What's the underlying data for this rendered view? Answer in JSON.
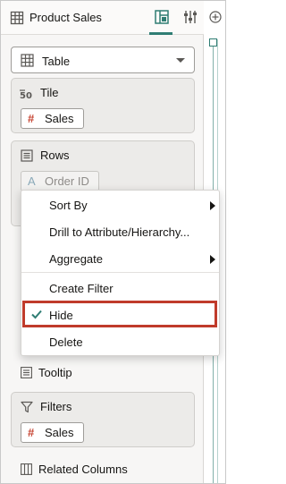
{
  "header": {
    "title": "Product Sales"
  },
  "viz_type": {
    "selected": "Table"
  },
  "sections": {
    "tile": {
      "title": "Tile",
      "chip": "Sales"
    },
    "rows": {
      "title": "Rows",
      "chip": "Order ID"
    },
    "tooltip": {
      "title": "Tooltip"
    },
    "filters": {
      "title": "Filters",
      "chip": "Sales"
    },
    "related": {
      "title": "Related Columns"
    }
  },
  "context_menu": {
    "items": [
      {
        "label": "Sort By",
        "submenu": true
      },
      {
        "label": "Drill to Attribute/Hierarchy..."
      },
      {
        "label": "Aggregate",
        "submenu": true
      },
      {
        "label": "Create Filter"
      },
      {
        "label": "Hide",
        "checked": true,
        "highlighted": true
      },
      {
        "label": "Delete"
      }
    ]
  },
  "colors": {
    "accent": "#2f7d73",
    "measure": "#c74634",
    "highlight": "#c03b2b"
  }
}
